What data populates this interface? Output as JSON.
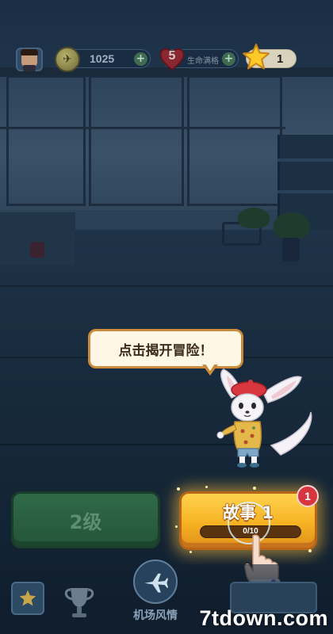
{
  "hud": {
    "coins": "1025",
    "lives": "5",
    "lives_status": "生命满格",
    "stars": "1"
  },
  "dialog": {
    "bubble_text": "点击揭开冒险！"
  },
  "level_button": {
    "label": "2级"
  },
  "story_button": {
    "title": "故事 1",
    "progress_text": "0/10",
    "progress_fraction": 0.0,
    "notification_count": "1"
  },
  "bottom_nav": {
    "home_icon": "house-star-icon",
    "trophy_icon": "trophy-icon",
    "airport_icon": "airplane-icon",
    "airport_label": "机场风情",
    "shop_icon": "shop-icon"
  },
  "watermark": "7tdown.com",
  "colors": {
    "story_gold": "#f6b223",
    "level_green": "#2f6a47",
    "badge_red": "#d6353f",
    "progress_green": "#9be05a"
  }
}
